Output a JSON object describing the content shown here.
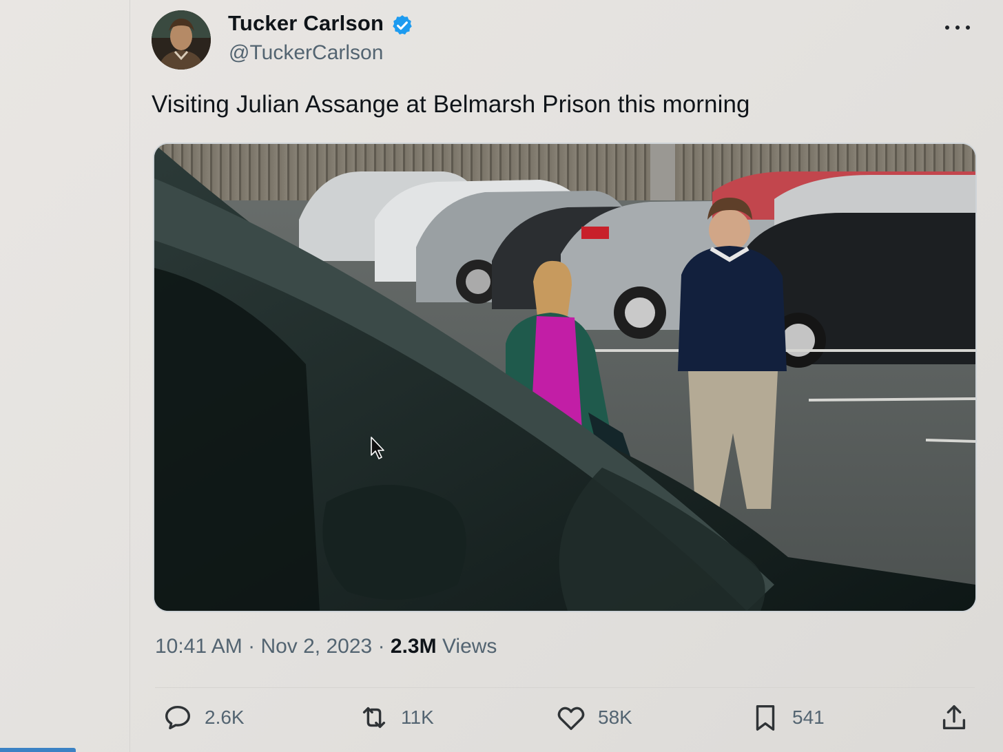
{
  "author": {
    "display_name": "Tucker Carlson",
    "handle": "@TuckerCarlson",
    "verified": true
  },
  "tweet": {
    "text": "Visiting Julian Assange at Belmarsh Prison this morning",
    "time": "10:41 AM",
    "date": "Nov 2, 2023",
    "views_count": "2.3M",
    "views_label": "Views"
  },
  "actions": {
    "reply_count": "2.6K",
    "retweet_count": "11K",
    "like_count": "58K",
    "bookmark_count": "541"
  },
  "icons": {
    "more": "more-horizontal-icon",
    "reply": "comment-bubble-icon",
    "retweet": "retweet-arrows-icon",
    "like": "heart-icon",
    "bookmark": "bookmark-icon",
    "share": "share-upload-icon",
    "verified": "verified-badge-icon",
    "cursor": "mouse-pointer-icon"
  },
  "colors": {
    "verified_blue": "#1d9bf0",
    "text_primary": "#0f1419",
    "text_secondary": "#536471"
  }
}
